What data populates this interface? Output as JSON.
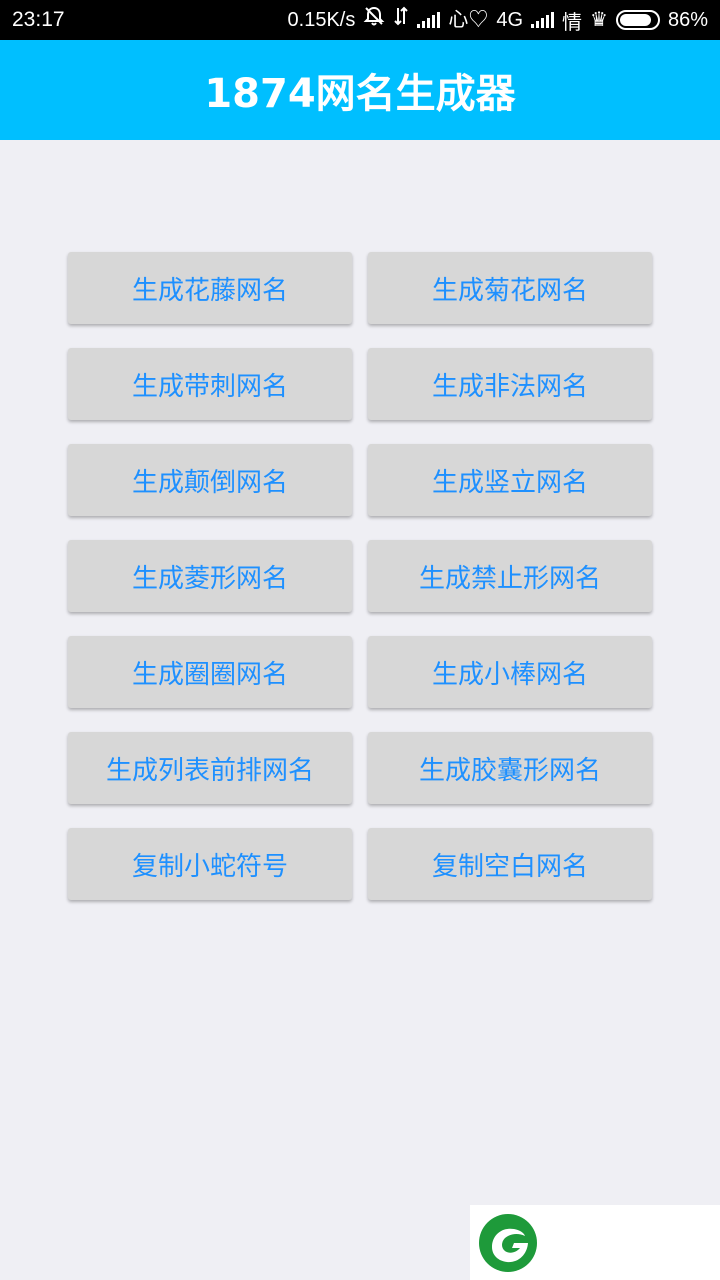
{
  "status_bar": {
    "time": "23:17",
    "net_speed": "0.15K/s",
    "network_type": "4G",
    "carrier": "情",
    "battery_percent": "86%",
    "battery_level": 0.86,
    "icons": [
      "bell-muted-icon",
      "data-arrows-icon",
      "signal-icon",
      "heart-icon",
      "crown-icon",
      "battery-icon"
    ]
  },
  "header": {
    "title": "1874网名生成器",
    "background_color": "#00bfff"
  },
  "buttons": [
    "生成花藤网名",
    "生成菊花网名",
    "生成带刺网名",
    "生成非法网名",
    "生成颠倒网名",
    "生成竖立网名",
    "生成菱形网名",
    "生成禁止形网名",
    "生成圈圈网名",
    "生成小棒网名",
    "生成列表前排网名",
    "生成胶囊形网名",
    "复制小蛇符号",
    "复制空白网名"
  ],
  "colors": {
    "button_background": "#d7d7d7",
    "button_text": "#1e90ff",
    "page_background": "#efeff4",
    "logo_green": "#1e9a3a"
  },
  "ad": {
    "logo_icon": "green-leaf-logo-icon"
  }
}
